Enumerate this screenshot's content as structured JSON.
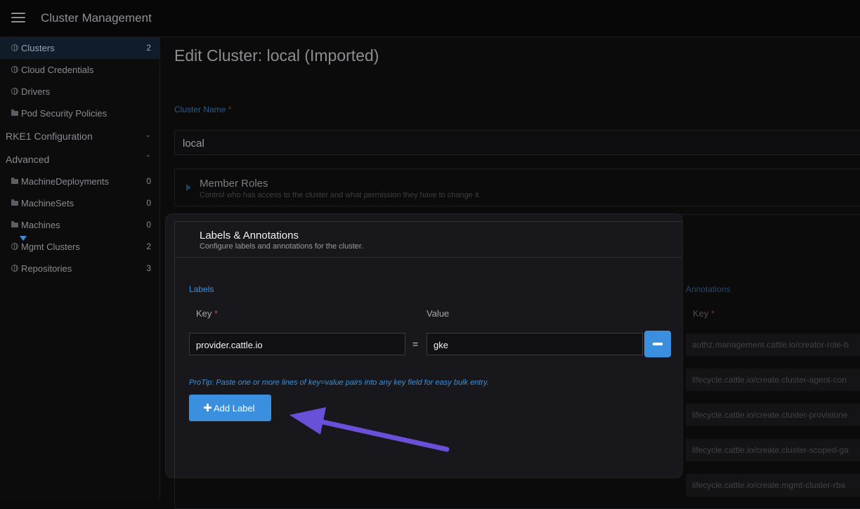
{
  "header": {
    "title": "Cluster Management"
  },
  "sidebar": {
    "items": [
      {
        "label": "Clusters",
        "count": "2",
        "icon": "globe-icon"
      },
      {
        "label": "Cloud Credentials",
        "count": "",
        "icon": "globe-icon"
      },
      {
        "label": "Drivers",
        "count": "",
        "icon": "globe-icon"
      },
      {
        "label": "Pod Security Policies",
        "count": "",
        "icon": "folder-icon"
      }
    ],
    "groups": [
      {
        "label": "RKE1 Configuration",
        "chevron": "⌄"
      },
      {
        "label": "Advanced",
        "chevron": "⌃"
      }
    ],
    "advanced_items": [
      {
        "label": "MachineDeployments",
        "count": "0",
        "icon": "folder-icon"
      },
      {
        "label": "MachineSets",
        "count": "0",
        "icon": "folder-icon"
      },
      {
        "label": "Machines",
        "count": "0",
        "icon": "folder-icon"
      },
      {
        "label": "Mgmt Clusters",
        "count": "2",
        "icon": "globe-icon"
      },
      {
        "label": "Repositories",
        "count": "3",
        "icon": "globe-icon"
      }
    ]
  },
  "main": {
    "title": "Edit Cluster: local (Imported)",
    "cluster_name_label": "Cluster Name",
    "required_mark": "*",
    "cluster_name_value": "local",
    "member_roles": {
      "title": "Member Roles",
      "subtitle": "Control who has access to the cluster and what permission they have to change it."
    },
    "labels_annotations": {
      "title": "Labels & Annotations",
      "subtitle": "Configure labels and annotations for the cluster.",
      "labels_title": "Labels",
      "key_header": "Key",
      "value_header": "Value",
      "label_rows": [
        {
          "key": "provider.cattle.io",
          "equals": "=",
          "value": "gke"
        }
      ],
      "protip": "ProTip: Paste one or more lines of key=value pairs into any key field for easy bulk entry.",
      "add_label": "Add Label"
    },
    "annotations": {
      "title": "Annotations",
      "key_header": "Key",
      "rows": [
        "authz.management.cattle.io/creator-role-b",
        "lifecycle.cattle.io/create.cluster-agent-con",
        "lifecycle.cattle.io/create.cluster-provisione",
        "lifecycle.cattle.io/create.cluster-scoped-ga",
        "lifecycle.cattle.io/create.mgmt-cluster-rba"
      ]
    }
  },
  "colors": {
    "accent": "#3a8fde",
    "arrow": "#6a4fd8",
    "required": "#d14a4a"
  }
}
